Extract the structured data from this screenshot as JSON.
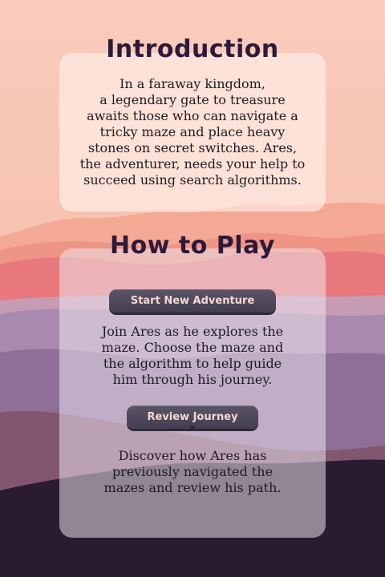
{
  "intro": {
    "title": "Introduction",
    "text": "In a faraway kingdom,\na legendary gate to treasure\nawaits those who can navigate a\ntricky maze and place heavy\nstones on secret switches. Ares,\nthe adventurer, needs your help to\nsucceed using search algorithms."
  },
  "how_to_play": {
    "title": "How to Play",
    "start_button": "Start New Adventure",
    "start_description": "Join Ares as he explores the\nmaze. Choose the maze and\nthe algorithm to help guide\nhim through his journey.",
    "review_button": "Review Journey",
    "review_description": "Discover how Ares has\npreviously navigated the\nmazes and review his path."
  },
  "colors": {
    "sky_top": "#f8c7b6",
    "sky_bottom": "#f6b9a5",
    "mountain_far": "#f0a38f",
    "mountain_mid": "#e77e7e",
    "mountain_purple": "#a98aae",
    "mountain_dark": "#8a6f93",
    "ground": "#2a1c30",
    "button": "#4b4558",
    "button_text": "#f4d9d2",
    "title_text": "#2b1a3a"
  }
}
